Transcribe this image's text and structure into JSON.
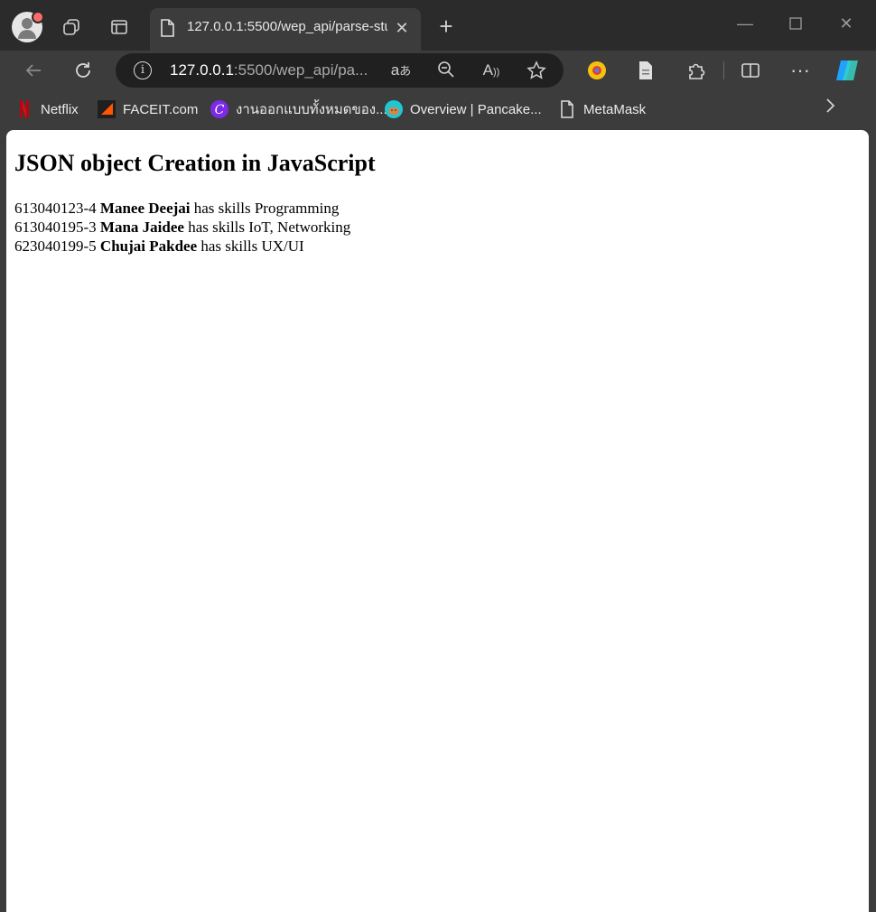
{
  "tab": {
    "title": "127.0.0.1:5500/wep_api/parse-stu"
  },
  "address": {
    "host": "127.0.0.1",
    "rest": ":5500/wep_api/pa..."
  },
  "bookmarks": [
    {
      "label": "Netflix"
    },
    {
      "label": "FACEIT.com"
    },
    {
      "label": "งานออกแบบทั้งหมดของ..."
    },
    {
      "label": "Overview | Pancake..."
    },
    {
      "label": "MetaMask"
    }
  ],
  "page": {
    "heading": "JSON object Creation in JavaScript",
    "students": [
      {
        "id": "613040123-4",
        "name": "Manee Deejai",
        "connector": " has skills ",
        "skills": "Programming"
      },
      {
        "id": "613040195-3",
        "name": "Mana Jaidee",
        "connector": " has skills ",
        "skills": "IoT, Networking"
      },
      {
        "id": "623040199-5",
        "name": "Chujai Pakdee",
        "connector": " has skills ",
        "skills": "UX/UI"
      }
    ]
  },
  "colors": {
    "titlebar": "#2b2b2b",
    "toolbar": "#3c3c3c",
    "address_bg": "#202020",
    "page_bg": "#ffffff"
  }
}
